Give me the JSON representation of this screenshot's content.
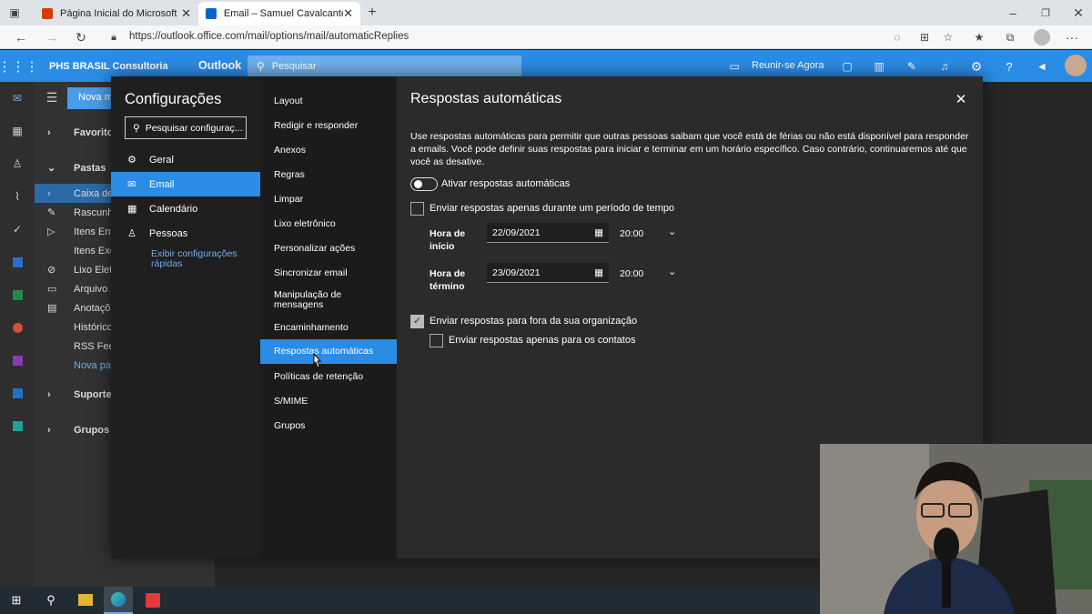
{
  "browser": {
    "tabs": [
      {
        "title": "Página Inicial do Microsoft Office"
      },
      {
        "title": "Email – Samuel Cavalcante | PHS"
      }
    ],
    "url": "https://outlook.office.com/mail/options/mail/automaticReplies"
  },
  "app": {
    "org_name": "PHS BRASIL Consultoria",
    "app_name": "Outlook",
    "search_placeholder": "Pesquisar",
    "meet_now": "Reunir-se Agora",
    "accent": "#2b8ce6"
  },
  "folders": {
    "new_button": "Nova m",
    "items": [
      "Favoritos",
      "Pastas",
      "Caixa de",
      "Rascunh",
      "Itens Env",
      "Itens Exc",
      "Lixo Eletr",
      "Arquivo",
      "Anotaçõ",
      "Históricc",
      "RSS Feed",
      "Nova pas",
      "Suporte",
      "Grupos"
    ]
  },
  "settings": {
    "title": "Configurações",
    "search_placeholder": "Pesquisar configuraç...",
    "nav": [
      "Geral",
      "Email",
      "Calendário",
      "Pessoas"
    ],
    "quick_link": "Exibir configurações rápidas",
    "sub_nav": [
      "Layout",
      "Redigir e responder",
      "Anexos",
      "Regras",
      "Limpar",
      "Lixo eletrônico",
      "Personalizar ações",
      "Sincronizar email",
      "Manipulação de mensagens",
      "Encaminhamento",
      "Respostas automáticas",
      "Políticas de retenção",
      "S/MIME",
      "Grupos"
    ],
    "selected_sub": "Respostas automáticas"
  },
  "auto_replies": {
    "title": "Respostas automáticas",
    "description": "Use respostas automáticas para permitir que outras pessoas saibam que você está de férias ou não está disponível para responder a emails. Você pode definir suas respostas para iniciar e terminar em um horário específico. Caso contrário, continuaremos até que você as desative.",
    "toggle_label": "Ativar respostas automáticas",
    "toggle_on": false,
    "period_label": "Enviar respostas apenas durante um período de tempo",
    "start_label": "Hora de início",
    "start_date": "22/09/2021",
    "start_time": "20:00",
    "end_label": "Hora de término",
    "end_date": "23/09/2021",
    "end_time": "20:00",
    "outside_label": "Enviar respostas para fora da sua organização",
    "outside_checked": true,
    "contacts_label": "Enviar respostas apenas para os contatos"
  }
}
